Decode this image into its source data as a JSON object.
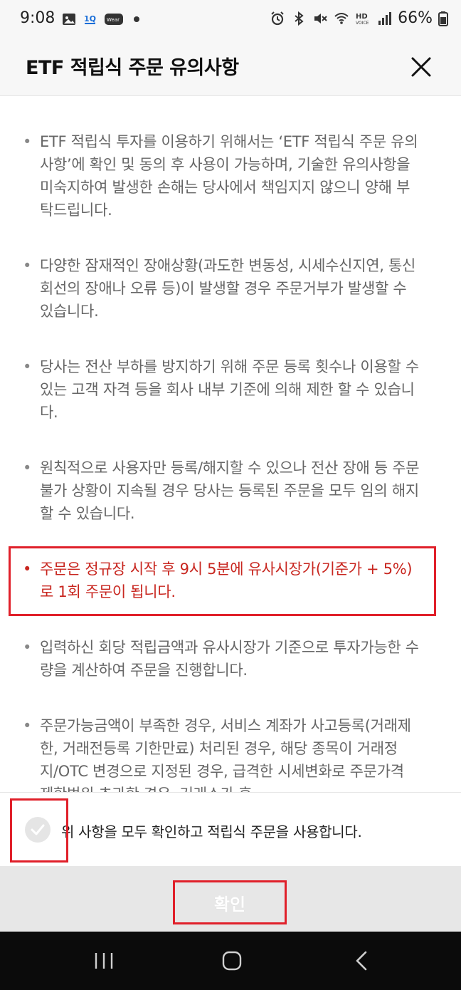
{
  "status_bar": {
    "time": "9:08",
    "left_icons": [
      "image-icon",
      "1q-icon",
      "wear-icon"
    ],
    "right_icons": [
      "alarm-icon",
      "bluetooth-icon",
      "mute-icon",
      "wifi-icon",
      "hd-voice-icon",
      "signal-icon",
      "battery-icon"
    ],
    "battery_text": "66%"
  },
  "header": {
    "title": "ETF 적립식 주문 유의사항",
    "close_icon": "close-icon"
  },
  "notices": [
    {
      "bullet": "•",
      "text": "ETF 적립식 투자를 이용하기 위해서는 ‘ETF 적립식 주문 유의사항’에 확인 및 동의 후 사용이 가능하며, 기술한 유의사항을 미숙지하여 발생한 손해는 당사에서 책임지지 않으니 양해 부탁드립니다."
    },
    {
      "bullet": "•",
      "text": "다양한 잠재적인 장애상황(과도한 변동성, 시세수신지연, 통신회선의 장애나 오류 등)이 발생할 경우 주문거부가 발생할 수 있습니다."
    },
    {
      "bullet": "•",
      "text": "당사는 전산 부하를 방지하기 위해 주문 등록 횟수나 이용할 수 있는 고객 자격 등을 회사 내부 기준에 의해 제한 할 수 있습니다."
    },
    {
      "bullet": "•",
      "text": "원칙적으로 사용자만 등록/해지할 수 있으나 전산 장애 등 주문불가 상황이 지속될 경우 당사는 등록된 주문을 모두 임의 해지 할 수 있습니다."
    },
    {
      "bullet": "•",
      "text": "주문은 정규장 시작 후 9시 5분에 유사시장가(기준가 + 5%)로 1회 주문이 됩니다."
    },
    {
      "bullet": "•",
      "text": "입력하신 회당 적립금액과 유사시장가 기준으로 투자가능한 수량을 계산하여 주문을 진행합니다."
    },
    {
      "bullet": "•",
      "text": "주문가능금액이 부족한 경우, 서비스 계좌가 사고등록(거래제한, 거래전등록 기한만료) 처리된 경우, 해당 종목이 거래정지/OTC 변경으로 지정된 경우, 급격한 시세변화로 주문가격 제한범위 초과한 경우, 거래소가 휴"
    }
  ],
  "agreement": {
    "text": "위 사항을 모두 확인하고 적립식 주문을 사용합니다.",
    "checked": false
  },
  "confirm_button": {
    "label": "확인"
  },
  "nav_bar": {
    "icons": [
      "recent-apps-icon",
      "home-icon",
      "back-icon"
    ]
  },
  "colors": {
    "highlight_red": "#c8261f",
    "outline_red": "#e0202a",
    "button_gray": "#e7e7e7",
    "text_gray": "#666666"
  }
}
